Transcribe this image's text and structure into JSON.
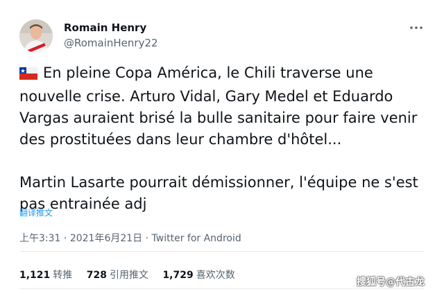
{
  "author": {
    "name": "Romain Henry",
    "handle": "@RomainHenry22"
  },
  "more_icon": "more-horizontal-icon",
  "tweet": {
    "flag_icon": "chile-flag-icon",
    "lines": [
      "En pleine Copa América, le Chili traverse une",
      "nouvelle crise. Arturo Vidal, Gary Medel et Eduardo",
      "Vargas auraient brisé la bulle sanitaire pour faire venir",
      "des prostituées dans leur chambre d'hôtel...",
      "Martin Lasarte pourrait démissionner, l'équipe ne s'est",
      "pas entrainée adj"
    ]
  },
  "translate_label": "翻译推文",
  "meta": {
    "time": "上午3:31",
    "separator": "·",
    "date": "2021年6月21日",
    "source": "Twitter for Android"
  },
  "stats": {
    "retweets": {
      "count": "1,121",
      "label": "转推"
    },
    "quotes": {
      "count": "728",
      "label": "引用推文"
    },
    "likes": {
      "count": "1,729",
      "label": "喜欢次数"
    }
  },
  "watermark": "搜狐号@代古龙",
  "colors": {
    "text": "#0f1419",
    "secondary": "#536471",
    "link": "#1d9bf0",
    "divider": "#e7e9ea"
  }
}
